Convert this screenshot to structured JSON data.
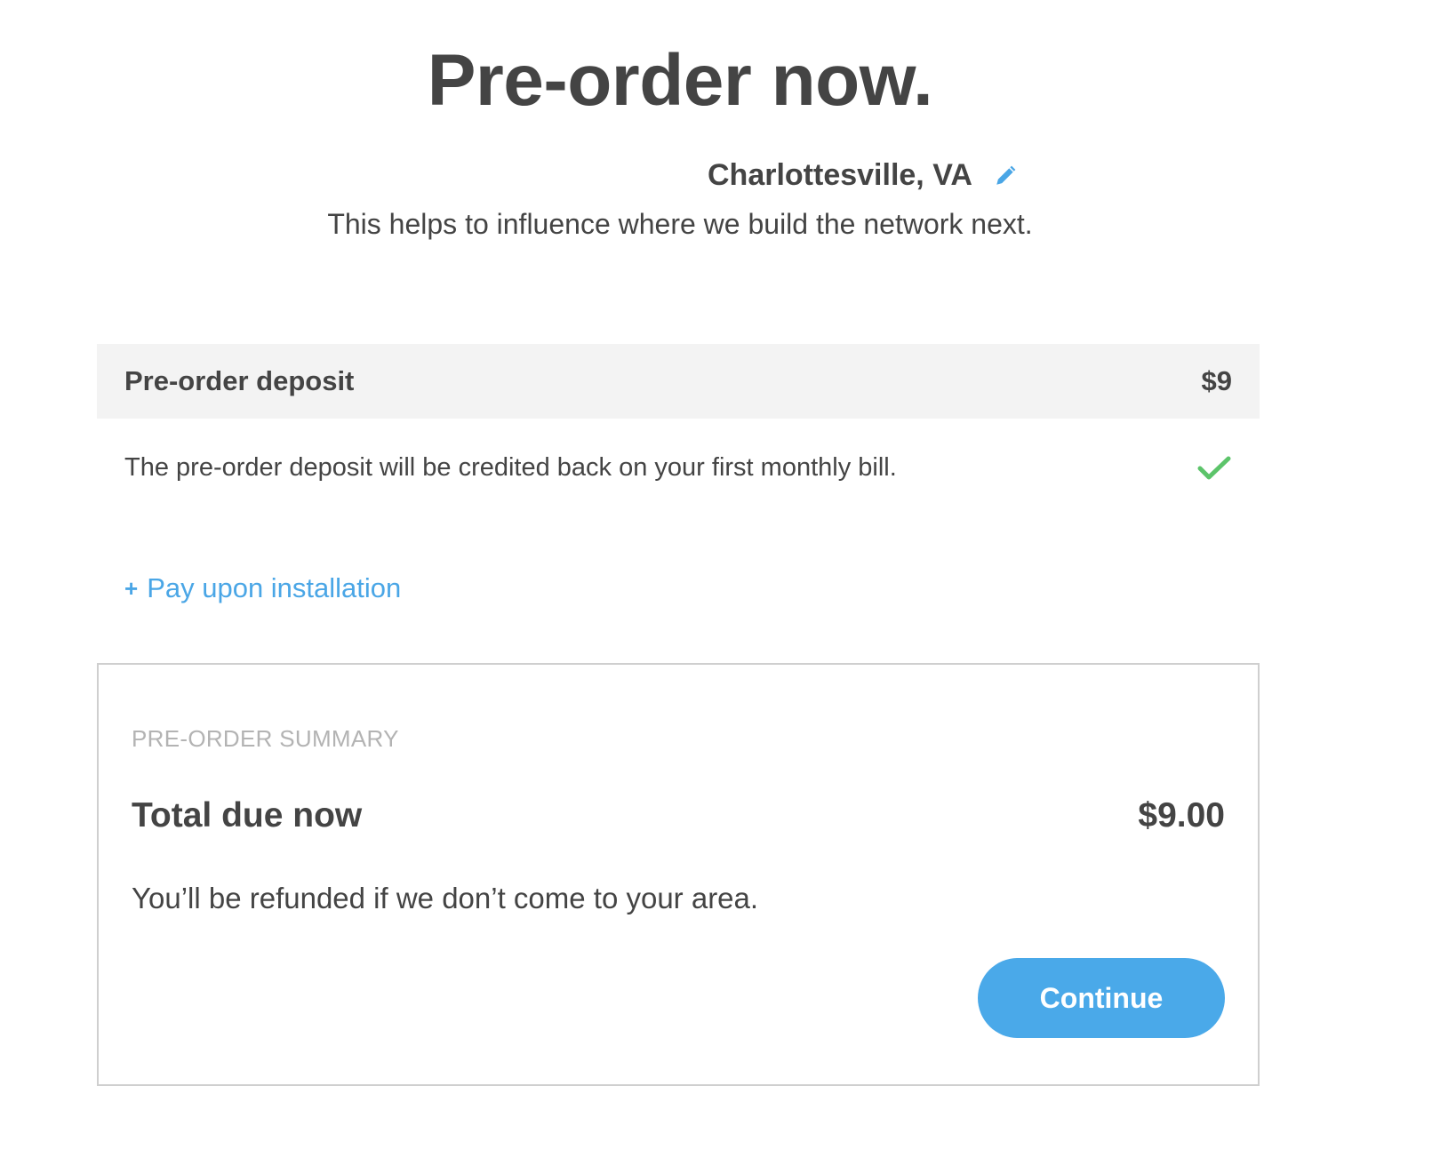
{
  "header": {
    "title": "Pre-order now."
  },
  "location": {
    "name": "Charlottesville, VA",
    "edit_icon": "pencil-icon",
    "subtitle": "This helps to influence where we build the network next."
  },
  "deposit": {
    "label": "Pre-order deposit",
    "price": "$9",
    "note": "The pre-order deposit will be credited back on your first monthly bill.",
    "status_icon": "checkmark-icon"
  },
  "payment_option": {
    "plus_symbol": "+",
    "label": "Pay upon installation"
  },
  "summary": {
    "heading": "PRE-ORDER SUMMARY",
    "total_label": "Total due now",
    "total_amount": "$9.00",
    "refund_note": "You’ll be refunded if we don’t come to your area.",
    "continue_label": "Continue"
  },
  "colors": {
    "accent": "#4aa9e9",
    "link": "#4aa6e6",
    "check": "#5cc46a",
    "text": "#444444",
    "muted": "#b3b3b3",
    "panel_bg": "#f3f3f3"
  }
}
